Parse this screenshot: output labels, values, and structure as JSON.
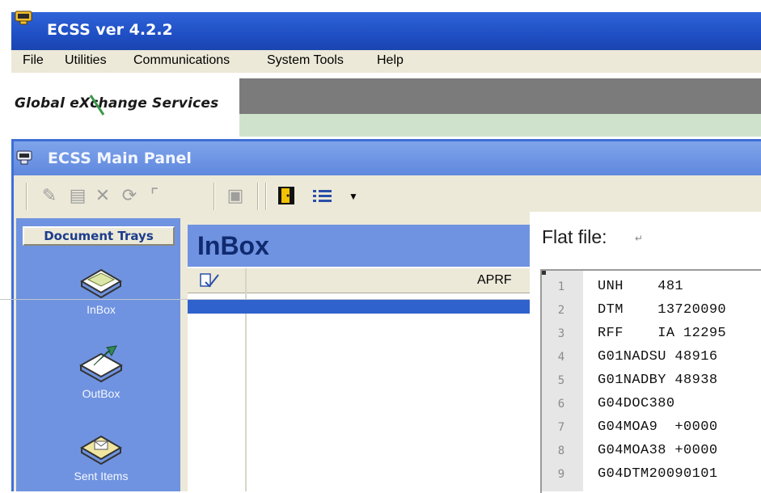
{
  "window": {
    "title": "ECSS ver 4.2.2"
  },
  "menu": [
    "File",
    "Utilities",
    "Communications",
    "System Tools",
    "Help"
  ],
  "banner": {
    "logo_text": "Global eXchange Services"
  },
  "panel": {
    "title": "ECSS Main Panel"
  },
  "sidebar": {
    "trays_button": "Document Trays",
    "items": [
      {
        "label": "InBox",
        "icon": "inbox-tray-icon"
      },
      {
        "label": "OutBox",
        "icon": "outbox-tray-icon"
      },
      {
        "label": "Sent Items",
        "icon": "sent-items-icon"
      }
    ]
  },
  "inbox": {
    "title": "InBox",
    "columns": [
      "APRF"
    ]
  },
  "flat_file": {
    "label": "Flat file:",
    "lines": [
      {
        "n": "1",
        "text": "UNH    481"
      },
      {
        "n": "2",
        "text": "DTM    13720090"
      },
      {
        "n": "3",
        "text": "RFF    IA 12295"
      },
      {
        "n": "4",
        "text": "G01NADSU 48916"
      },
      {
        "n": "5",
        "text": "G01NADBY 48938"
      },
      {
        "n": "6",
        "text": "G04DOC380"
      },
      {
        "n": "7",
        "text": "G04MOA9  +0000"
      },
      {
        "n": "8",
        "text": "G04MOA38 +0000"
      },
      {
        "n": "9",
        "text": "G04DTM20090101"
      }
    ]
  },
  "colors": {
    "titlebar": "#1f4fc4",
    "panel_title": "#6c93e3",
    "sidebar": "#6f93e0",
    "selection": "#2f62cc"
  }
}
